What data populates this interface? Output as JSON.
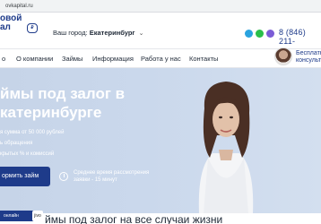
{
  "browser": {
    "url": "ovkapital.ru"
  },
  "header": {
    "logo_line1": "овой",
    "logo_line2": "ал",
    "city_label": "Ваш город:",
    "city_value": "Екатеринбург",
    "phone": "8 (846) 211-"
  },
  "nav": {
    "items": [
      "о",
      "О компании",
      "Займы",
      "Информация",
      "Работа у нас",
      "Контакты"
    ]
  },
  "consult": {
    "line1": "Бесплатн",
    "line2": "консульт"
  },
  "hero": {
    "title_line1": "ймы под залог в",
    "title_line2": "катеринбурге",
    "bullets": [
      "я сумма от 50 000 рублей",
      "ь обращения",
      "крытых % и комиссий"
    ],
    "cta_label": "ормить займ",
    "review_line1": "Среднее время рассмотрения",
    "review_line2": "заявки - 15 минут"
  },
  "bottom": {
    "title": "ймы под залог на все случаи жизни",
    "chat_label": "онлайн",
    "jivo_label": "jivo"
  },
  "colors": {
    "brand": "#1e3b8a",
    "hero_bg": "#c6d4e8"
  }
}
